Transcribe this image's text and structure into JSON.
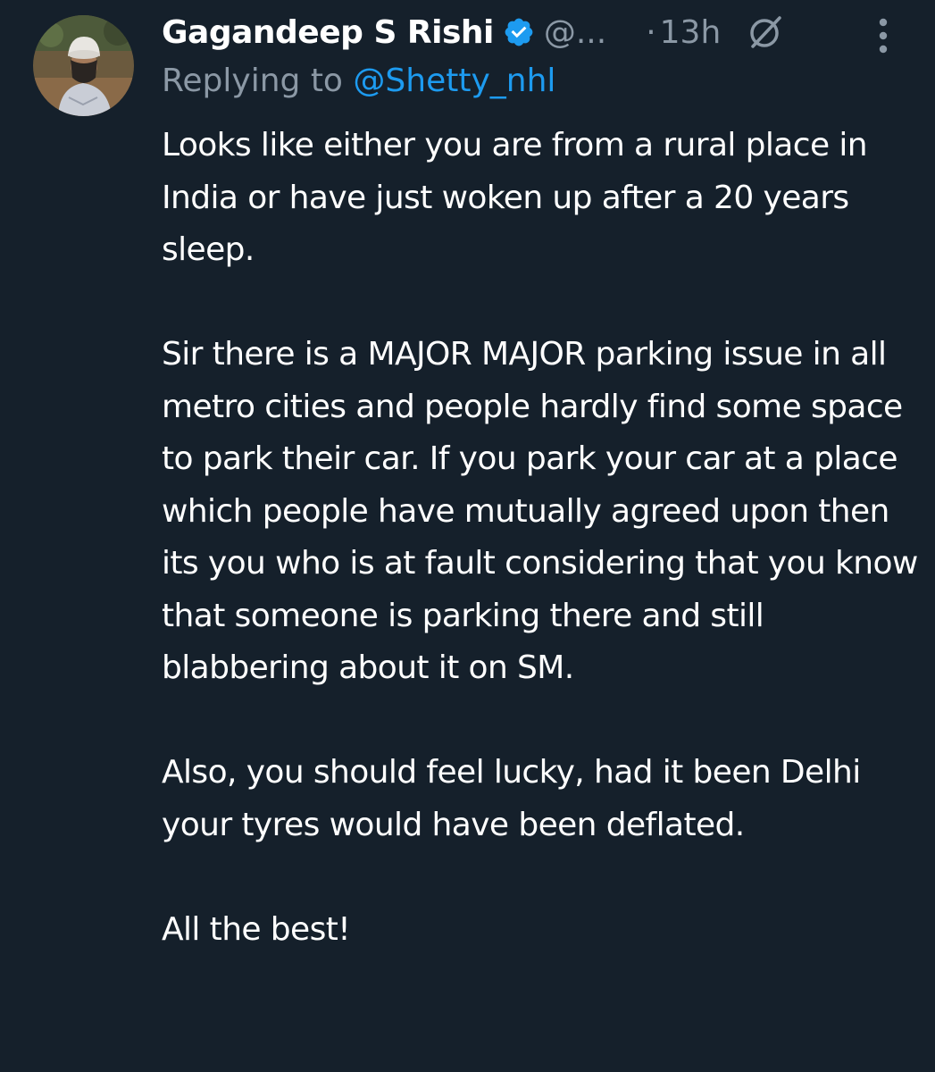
{
  "tweet": {
    "author": {
      "display_name": "Gagandeep S Rishi",
      "handle": "@...",
      "verified_icon": "verified-badge-icon",
      "avatar": "avatar-photo"
    },
    "meta": {
      "separator": "·",
      "timestamp": "13h",
      "grok_icon": "grok-icon",
      "more_icon": "more-vertical-icon"
    },
    "reply": {
      "prefix": "Replying to",
      "mention": "@Shetty_nhl"
    },
    "paragraphs": [
      "Looks like either you are from a rural place in India or have just woken up after a 20 years sleep.",
      "Sir there is a MAJOR MAJOR parking issue in all metro cities and people hardly find some space to park their car. If you park your car at a place which people have mutually agreed upon then its you who is at fault considering that you know that someone is parking there and still blabbering about it on SM.",
      "Also, you should feel lucky, had it been Delhi your tyres would have been deflated.",
      "All the best!"
    ]
  },
  "colors": {
    "background": "#15202b",
    "primary_text": "#ffffff",
    "secondary_text": "#8b98a5",
    "accent": "#1d9bf0"
  }
}
